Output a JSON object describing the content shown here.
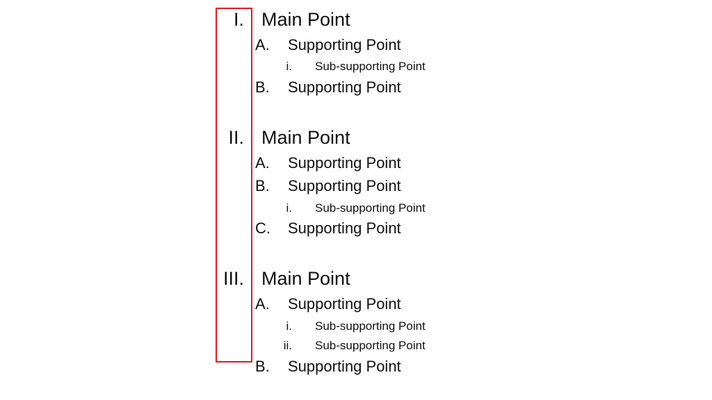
{
  "highlight_color": "#e3191f",
  "outline": [
    {
      "numeral": "I.",
      "text": "Main Point",
      "children": [
        {
          "label": "A.",
          "text": "Supporting Point",
          "children": [
            {
              "label": "i.",
              "text": "Sub-supporting Point"
            }
          ]
        },
        {
          "label": "B.",
          "text": "Supporting Point",
          "children": []
        }
      ]
    },
    {
      "numeral": "II.",
      "text": "Main Point",
      "children": [
        {
          "label": "A.",
          "text": "Supporting Point",
          "children": []
        },
        {
          "label": "B.",
          "text": "Supporting Point",
          "children": [
            {
              "label": "i.",
              "text": "Sub-supporting Point"
            }
          ]
        },
        {
          "label": "C.",
          "text": "Supporting Point",
          "children": []
        }
      ]
    },
    {
      "numeral": "III.",
      "text": "Main Point",
      "children": [
        {
          "label": "A.",
          "text": "Supporting Point",
          "children": [
            {
              "label": "i.",
              "text": "Sub-supporting Point"
            },
            {
              "label": "ii.",
              "text": "Sub-supporting Point"
            }
          ]
        },
        {
          "label": "B.",
          "text": "Supporting Point",
          "children": []
        }
      ]
    }
  ]
}
